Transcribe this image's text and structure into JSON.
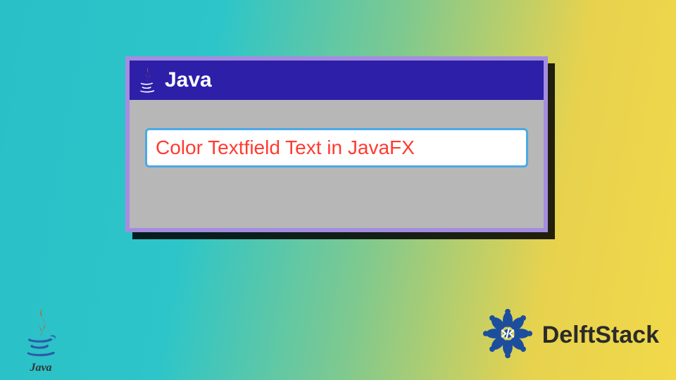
{
  "window": {
    "title": "Java",
    "textfield_value": "Color Textfield Text in JavaFX",
    "accent_color": "#4aa9e6",
    "text_color": "#ff3b30",
    "titlebar_color": "#2d1fa8"
  },
  "footer": {
    "java_label": "Java",
    "brand": "DelftStack"
  }
}
